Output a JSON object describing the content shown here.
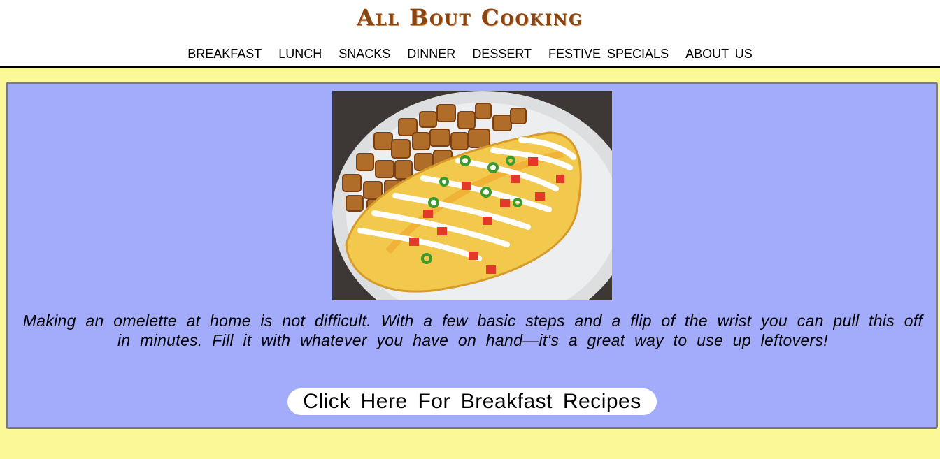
{
  "header": {
    "title": "All Bout Cooking",
    "nav": [
      {
        "label": "BREAKFAST"
      },
      {
        "label": "LUNCH"
      },
      {
        "label": "SNACKS"
      },
      {
        "label": "DINNER"
      },
      {
        "label": "DESSERT"
      },
      {
        "label": "FESTIVE SPECIALS"
      },
      {
        "label": "ABOUT US"
      }
    ]
  },
  "main": {
    "image_subject": "omelette-with-home-fries-photo",
    "description": "Making an omelette at home is not difficult. With a few basic steps and a flip of the wrist you can pull this off in minutes. Fill it with whatever you have on hand—it's a great way to use up leftovers!",
    "cta_label": "Click Here For Breakfast Recipes"
  },
  "colors": {
    "title": "#8b4513",
    "page_background": "#fbf898",
    "card_background": "#a2acfb",
    "card_border": "#7a7a7a",
    "button_background": "#ffffff"
  }
}
